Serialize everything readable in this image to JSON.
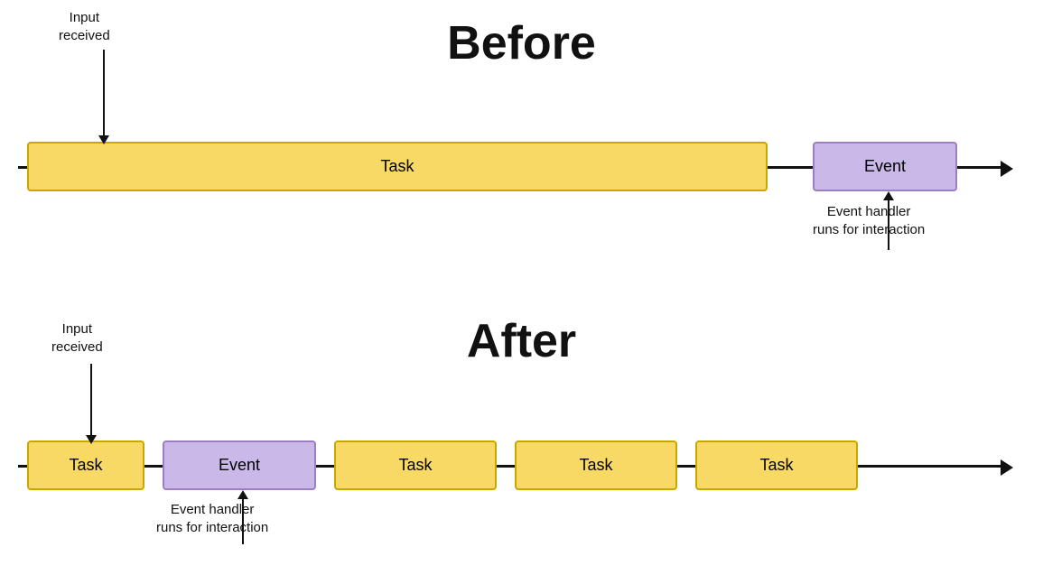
{
  "before": {
    "title": "Before",
    "annotation_input": "Input\nreceived",
    "annotation_event_handler": "Event handler\nruns for interaction",
    "task_label": "Task",
    "event_label": "Event"
  },
  "after": {
    "title": "After",
    "annotation_input": "Input\nreceived",
    "annotation_event_handler": "Event handler\nruns for interaction",
    "task_label": "Task",
    "event_label": "Event",
    "task2_label": "Task",
    "task3_label": "Task",
    "task4_label": "Task"
  },
  "colors": {
    "task_bg": "#f9d966",
    "task_border": "#c8a800",
    "event_bg": "#c9b8e8",
    "event_border": "#9b7fc0",
    "text": "#111111",
    "line": "#111111"
  }
}
